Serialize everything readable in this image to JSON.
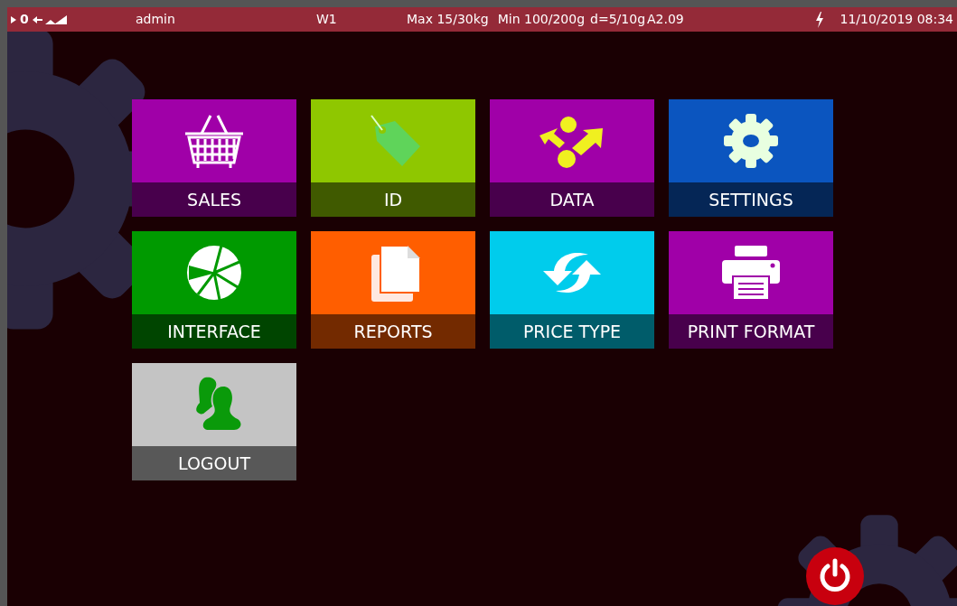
{
  "status_bar": {
    "zero": "0",
    "user": "admin",
    "platform": "W1",
    "max": "Max 15/30kg",
    "min": "Min 100/200g",
    "division": "d=5/10g",
    "version": "A2.09",
    "datetime": "11/10/2019 08:34"
  },
  "tiles": [
    {
      "label": "SALES",
      "kind": "basket",
      "color": "#a000a8"
    },
    {
      "label": "ID",
      "kind": "tag",
      "color": "#8fc700"
    },
    {
      "label": "DATA",
      "kind": "arrows",
      "color": "#a000a8"
    },
    {
      "label": "SETTINGS",
      "kind": "gear",
      "color": "#0b55bf"
    },
    {
      "label": "INTERFACE",
      "kind": "chart",
      "color": "#009a00"
    },
    {
      "label": "REPORTS",
      "kind": "documents",
      "color": "#ff5e00"
    },
    {
      "label": "PRICE TYPE",
      "kind": "refresh",
      "color": "#00ccec"
    },
    {
      "label": "PRINT FORMAT",
      "kind": "printer",
      "color": "#a000a8"
    },
    {
      "label": "LOGOUT",
      "kind": "users",
      "color": "#c4c4c4"
    }
  ]
}
